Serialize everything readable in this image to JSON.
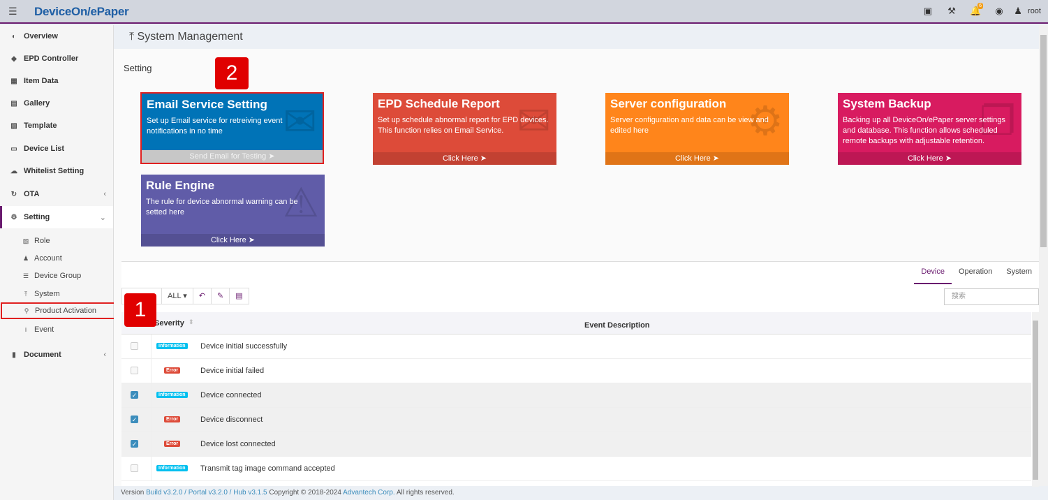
{
  "app": {
    "brand": "DeviceOn/ePaper",
    "user": "root",
    "notif_count": "6"
  },
  "sidebar": {
    "items": [
      {
        "label": "Overview",
        "icon": "dashboard-icon"
      },
      {
        "label": "EPD Controller",
        "icon": "tags-icon"
      },
      {
        "label": "Item Data",
        "icon": "table-icon"
      },
      {
        "label": "Gallery",
        "icon": "image-icon"
      },
      {
        "label": "Template",
        "icon": "id-card-icon"
      },
      {
        "label": "Device List",
        "icon": "desktop-icon"
      },
      {
        "label": "Whitelist Setting",
        "icon": "cloud-upload-icon"
      },
      {
        "label": "OTA",
        "icon": "refresh-icon"
      },
      {
        "label": "Setting",
        "icon": "cogs-icon"
      },
      {
        "label": "Document",
        "icon": "book-icon"
      }
    ],
    "sub_items": [
      {
        "label": "Role",
        "icon": "id-badge-icon"
      },
      {
        "label": "Account",
        "icon": "user-icon"
      },
      {
        "label": "Device Group",
        "icon": "list-icon"
      },
      {
        "label": "System",
        "icon": "wrench-icon"
      },
      {
        "label": "Product Activation",
        "icon": "key-icon"
      },
      {
        "label": "Event",
        "icon": "info-icon"
      }
    ]
  },
  "header": {
    "title": "System Management"
  },
  "main": {
    "section_title": "Setting",
    "cards": {
      "email": {
        "title": "Email Service Setting",
        "desc": "Set up Email service for retreiving event notifications in no time",
        "footer": "Send Email for Testing"
      },
      "epd": {
        "title": "EPD Schedule Report",
        "desc": "Set up schedule abnormal report for EPD devices. This function relies on Email Service.",
        "footer": "Click Here"
      },
      "server": {
        "title": "Server configuration",
        "desc": "Server configuration and data can be view and edited here",
        "footer": "Click Here"
      },
      "backup": {
        "title": "System Backup",
        "desc": "Backing up all DeviceOn/ePaper server settings and database. This function allows scheduled remote backups with adjustable retention.",
        "footer": "Click Here"
      },
      "rule": {
        "title": "Rule Engine",
        "desc": "The rule for device abnormal warning can be setted here",
        "footer": "Click Here"
      }
    },
    "markers": {
      "one": "1",
      "two": "2"
    }
  },
  "events": {
    "tabs": [
      "Device",
      "Operation",
      "System"
    ],
    "active_tab": "Device",
    "toolbar": {
      "filter_label": "ALL"
    },
    "search_placeholder": "搜索",
    "columns": {
      "severity": "Severity",
      "description": "Event Description"
    },
    "rows": [
      {
        "checked": false,
        "severity": "Information",
        "desc": "Device initial successfully"
      },
      {
        "checked": false,
        "severity": "Error",
        "desc": "Device initial failed"
      },
      {
        "checked": true,
        "severity": "Information",
        "desc": "Device connected"
      },
      {
        "checked": true,
        "severity": "Error",
        "desc": "Device disconnect"
      },
      {
        "checked": true,
        "severity": "Error",
        "desc": "Device lost connected"
      },
      {
        "checked": false,
        "severity": "Information",
        "desc": "Transmit tag image command accepted"
      }
    ]
  },
  "footer": {
    "prefix": "Version",
    "versions": "Build v3.2.0 / Portal v3.2.0 / Hub v3.1.5",
    "copyright": "Copyright © 2018-2024",
    "company": "Advantech Corp.",
    "suffix": "All rights reserved."
  },
  "colors": {
    "accent": "#6a1b6f",
    "email": "#0073b7",
    "epd": "#dd4b39",
    "server": "#ff851b",
    "backup": "#d81b60",
    "rule": "#605ca8",
    "highlight": "#e02020"
  }
}
